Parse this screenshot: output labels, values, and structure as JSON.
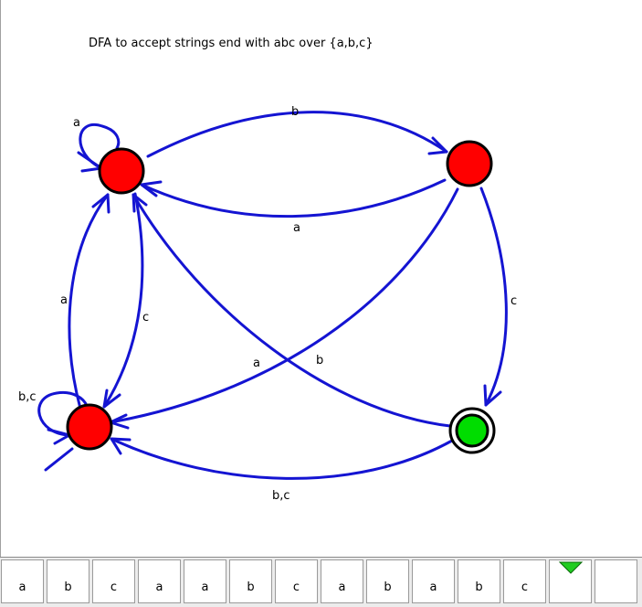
{
  "title": "DFA to accept strings end with abc over {a,b,c}",
  "colors": {
    "edge": "#1414d2",
    "state_fill": "#ff0000",
    "accept_fill": "#00dd00",
    "state_stroke": "#000000",
    "head_marker": "#22cc22"
  },
  "states": [
    {
      "id": "q0",
      "type": "normal"
    },
    {
      "id": "q1",
      "type": "normal"
    },
    {
      "id": "q2",
      "type": "normal"
    },
    {
      "id": "q3",
      "type": "accepting"
    }
  ],
  "edge_labels": {
    "q0_self": "a",
    "q0_q1": "b",
    "q1_q0": "a",
    "q1_q3": "c",
    "q1_q2": "a",
    "q3_q0": "b",
    "q2_q0": "a",
    "q0_q2": "c",
    "q2_self": "b,c",
    "q3_q2": "b,c"
  },
  "tape": {
    "cells": [
      "a",
      "b",
      "c",
      "a",
      "a",
      "b",
      "c",
      "a",
      "b",
      "a",
      "b",
      "c",
      "",
      ""
    ],
    "head_index": 12,
    "head_icon": "down-triangle-icon"
  }
}
